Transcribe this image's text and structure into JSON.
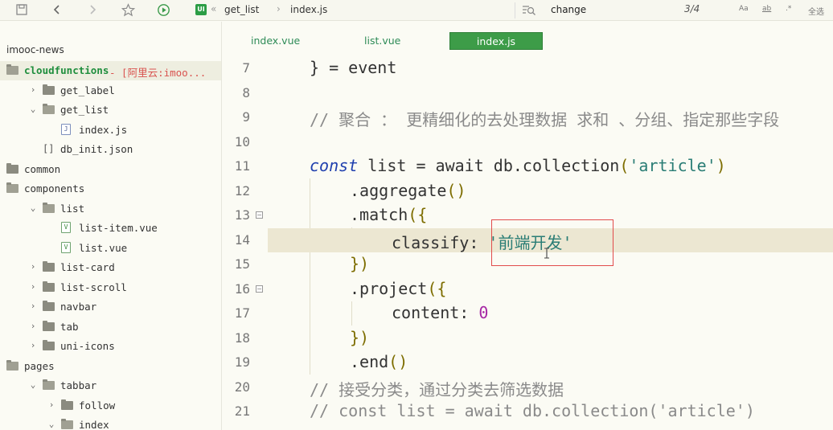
{
  "toolbar": {
    "icons": [
      "save-icon",
      "back-icon",
      "forward-icon",
      "star-icon",
      "run-icon"
    ],
    "breadcrumb": {
      "badge": "UI",
      "sep1": "«",
      "folder": "get_list",
      "sep2": "›",
      "file": "index.js"
    },
    "find": {
      "query": "change",
      "count": "3/4",
      "opt_case": "Aa",
      "opt_word": "ab",
      "opt_regex": ".*",
      "select_all": "全选"
    }
  },
  "sidebar": {
    "project": "imooc-news",
    "rows": [
      {
        "label": "cloudfunctions",
        "suffix": " - [阿里云:imoo...",
        "type": "folder-open",
        "depth": 0,
        "selected": true,
        "bold": true
      },
      {
        "label": "get_label",
        "type": "folder",
        "depth": 1,
        "arrow": "›"
      },
      {
        "label": "get_list",
        "type": "folder-open",
        "depth": 1,
        "arrow": "⌄"
      },
      {
        "label": "index.js",
        "type": "file-js",
        "depth": 2
      },
      {
        "label": "db_init.json",
        "type": "json",
        "depth": 1
      },
      {
        "label": "common",
        "type": "folder",
        "depth": 0
      },
      {
        "label": "components",
        "type": "folder-open",
        "depth": 0
      },
      {
        "label": "list",
        "type": "folder-open",
        "depth": 1,
        "arrow": "⌄"
      },
      {
        "label": "list-item.vue",
        "type": "file-vue",
        "depth": 2
      },
      {
        "label": "list.vue",
        "type": "file-vue",
        "depth": 2
      },
      {
        "label": "list-card",
        "type": "folder",
        "depth": 1,
        "arrow": "›"
      },
      {
        "label": "list-scroll",
        "type": "folder",
        "depth": 1,
        "arrow": "›"
      },
      {
        "label": "navbar",
        "type": "folder",
        "depth": 1,
        "arrow": "›"
      },
      {
        "label": "tab",
        "type": "folder",
        "depth": 1,
        "arrow": "›"
      },
      {
        "label": "uni-icons",
        "type": "folder",
        "depth": 1,
        "arrow": "›"
      },
      {
        "label": "pages",
        "type": "folder-open",
        "depth": 0
      },
      {
        "label": "tabbar",
        "type": "folder-open",
        "depth": 1,
        "arrow": "⌄"
      },
      {
        "label": "follow",
        "type": "folder",
        "depth": 2,
        "arrow": "›"
      },
      {
        "label": "index",
        "type": "folder-open",
        "depth": 2,
        "arrow": "⌄"
      }
    ]
  },
  "tabs": [
    {
      "label": "index.vue",
      "active": false
    },
    {
      "label": "list.vue",
      "active": false
    },
    {
      "label": "index.js",
      "active": true
    }
  ],
  "editor": {
    "lines": [
      {
        "n": "7"
      },
      {
        "n": "8"
      },
      {
        "n": "9"
      },
      {
        "n": "10"
      },
      {
        "n": "11"
      },
      {
        "n": "12"
      },
      {
        "n": "13"
      },
      {
        "n": "14"
      },
      {
        "n": "15"
      },
      {
        "n": "16"
      },
      {
        "n": "17"
      },
      {
        "n": "18"
      },
      {
        "n": "19"
      },
      {
        "n": "20"
      },
      {
        "n": "21"
      }
    ],
    "code": {
      "l7_brace": "}",
      "l7_rest": " = event",
      "l9_comment": "// 聚合 ： 更精细化的去处理数据 求和 、分组、指定那些字段",
      "l11_const": "const",
      "l11_list": " list = ",
      "l11_await": "await",
      "l11_db": " db.collection",
      "l11_open": "(",
      "l11_str": "'article'",
      "l11_close": ")",
      "l12": ".aggregate",
      "l12_p": "()",
      "l13": ".match",
      "l13_p": "({",
      "l14_key": "classify: ",
      "l14_val": "'前端开发'",
      "l15": "})",
      "l16": ".project",
      "l16_p": "({",
      "l17_key": "content: ",
      "l17_val": "0",
      "l18": "})",
      "l19": ".end",
      "l19_p": "()",
      "l20_comment": "// 接受分类，通过分类去筛选数据",
      "l21_comment": "// const list = await db.collection('article')"
    }
  }
}
